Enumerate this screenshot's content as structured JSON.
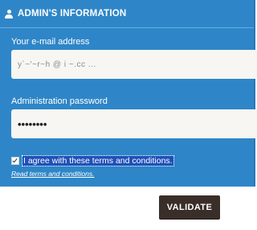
{
  "panel": {
    "title": "ADMIN'S INFORMATION",
    "icon": "user-icon"
  },
  "email": {
    "label": "Your e-mail address",
    "value": "y`~'~r~h @ i   ~.cc ..."
  },
  "password": {
    "label": "Administration password",
    "value": "••••••••"
  },
  "terms": {
    "checked": true,
    "agree_text": "I agree with these terms and conditions.",
    "link_text": "Read terms and conditions."
  },
  "actions": {
    "validate_label": "VALIDATE"
  },
  "colors": {
    "panel": "#2e86c8",
    "field": "#f7f6f3",
    "button": "#3a2e29",
    "selection": "#2050b8"
  }
}
